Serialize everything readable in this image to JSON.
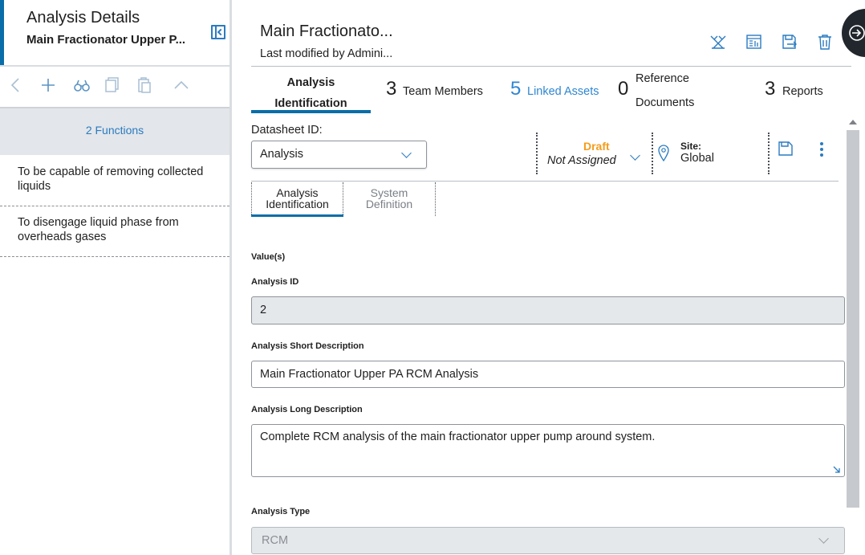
{
  "left_panel": {
    "title": "Analysis Details",
    "subtitle": "Main Fractionator Upper P...",
    "toolbar_icons": [
      "back-icon",
      "add-icon",
      "binoculars-icon",
      "copy-icon",
      "paste-icon",
      "collapse-up-icon"
    ],
    "functions_header": "2 Functions",
    "functions": [
      {
        "line1": "To be capable of removing collected",
        "line2": "liquids"
      },
      {
        "line1": "To disengage liquid phase from",
        "line2": "overheads gases"
      }
    ]
  },
  "header": {
    "title": "Main Fractionato...",
    "subtitle": "Last modified by Admini...",
    "icons": [
      "network-icon",
      "report-icon",
      "export-icon",
      "delete-icon"
    ]
  },
  "tabs": [
    {
      "label_line1": "Analysis",
      "label_line2": "Identification",
      "active": true
    },
    {
      "count": "3",
      "label": "Team Members"
    },
    {
      "count": "5",
      "label": "Linked Assets",
      "color": "#2f86d1"
    },
    {
      "count": "0",
      "label_line1": "Reference",
      "label_line2": "Documents"
    },
    {
      "count": "3",
      "label": "Reports"
    }
  ],
  "datasheet": {
    "label": "Datasheet ID:",
    "value": "Analysis",
    "state": "Draft",
    "state_color": "#f59c1a",
    "assignee": "Not Assigned",
    "site_label": "Site:",
    "site_value": "Global"
  },
  "subtabs": [
    {
      "line1": "Analysis",
      "line2": "Identification",
      "active": true
    },
    {
      "line1": "System",
      "line2": "Definition",
      "active": false
    }
  ],
  "form": {
    "section_label": "Value(s)",
    "analysis_id_label": "Analysis ID",
    "analysis_id_value": "2",
    "short_desc_label": "Analysis Short Description",
    "short_desc_value": "Main Fractionator Upper PA RCM Analysis",
    "long_desc_label": "Analysis Long Description",
    "long_desc_value": "Complete RCM analysis of the main fractionator upper pump around system.",
    "type_label": "Analysis Type",
    "type_value": "RCM"
  },
  "colors": {
    "accent": "#0a6ea8",
    "link": "#2f86d1",
    "draft": "#f59c1a"
  }
}
